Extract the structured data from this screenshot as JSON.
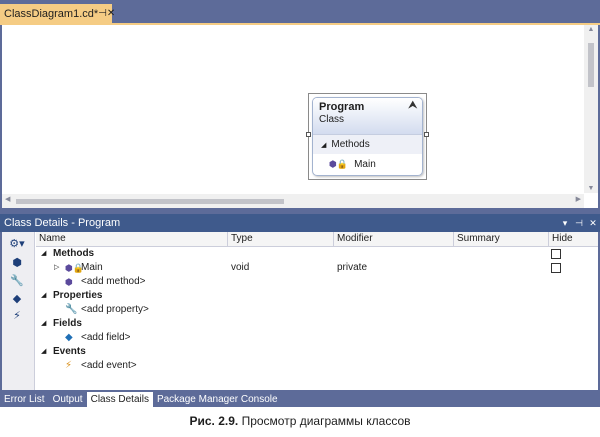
{
  "document_tab": {
    "title": "ClassDiagram1.cd*",
    "pin_glyph": "⊣",
    "close_glyph": "✕"
  },
  "diagram": {
    "class_name": "Program",
    "class_kind": "Class",
    "collapse_glyph": "⮝",
    "compartment_label": "Methods",
    "method_name": "Main"
  },
  "class_details": {
    "title": "Class Details - Program",
    "title_buttons": [
      "▾",
      "⊣",
      "✕"
    ],
    "columns": [
      "Name",
      "Type",
      "Modifier",
      "Summary",
      "Hide"
    ],
    "methods_group": "Methods",
    "main_method": {
      "name": "Main",
      "type": "void",
      "modifier": "private"
    },
    "add_method": "<add method>",
    "properties_group": "Properties",
    "add_property": "<add property>",
    "fields_group": "Fields",
    "add_field": "<add field>",
    "events_group": "Events",
    "add_event": "<add event>"
  },
  "bottom_tabs": [
    "Error List",
    "Output",
    "Class Details",
    "Package Manager Console"
  ],
  "active_tab": "Class Details",
  "caption": {
    "label": "Рис. 2.9.",
    "text": " Просмотр диаграммы классов"
  }
}
